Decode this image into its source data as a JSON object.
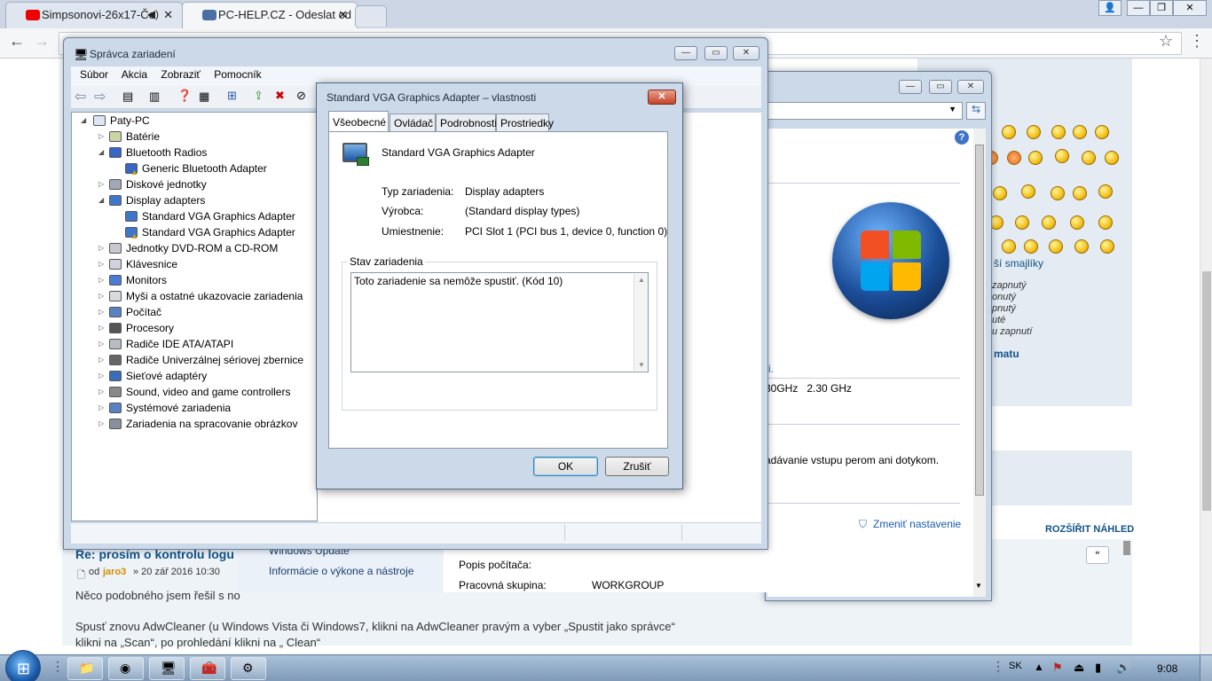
{
  "browser": {
    "tabs": [
      {
        "label": "Simpsonovi-26x17-Če",
        "active": false
      },
      {
        "label": "PC-HELP.CZ - Odeslat od",
        "active": true
      }
    ]
  },
  "page": {
    "post_title": "Re: prosím o kontrolu logu",
    "post_meta_prefix": "od",
    "post_author": "jaro3",
    "post_date": "» 20 zář 2016 10:30",
    "post_text1": "Něco podobného jsem řešil s no",
    "post_text2": "Spusť znovu AdwCleaner (u Windows Vista či Windows7, klikni na AdwCleaner pravým a vyber „Spustit jako správce“",
    "post_text3": "klikni na „Scan“, po prohledání klikni na „ Clean“",
    "expand_view": "ROZŠÍŘIT NÁHLED",
    "more_smileys": "ší smajlíky",
    "opts": [
      "zapnutý",
      "onutý",
      "pnutý",
      "uté",
      "u zapnutí"
    ],
    "opt_bold": "matu"
  },
  "sysinfo_window": {
    "fragment_i": "i.",
    "cpu_speed": "30GHz   2.30 GHz",
    "pen_text": "adávanie vstupu perom ani dotykom.",
    "change_settings": "Zmeniť nastavenie",
    "windows_update": "Windows Update",
    "perf_info": "Informácie o výkone a nástroje",
    "computer_desc_label": "Popis počítača:",
    "workgroup_label": "Pracovná skupina:",
    "workgroup_value": "WORKGROUP"
  },
  "devmgr": {
    "title": "Správca zariadení",
    "menu": [
      "Súbor",
      "Akcia",
      "Zobraziť",
      "Pomocník"
    ],
    "root": "Paty-PC",
    "nodes": [
      {
        "label": "Batérie",
        "level": 1,
        "icon": "battery-icon",
        "expanded": false
      },
      {
        "label": "Bluetooth Radios",
        "level": 1,
        "icon": "bluetooth-icon",
        "expanded": true
      },
      {
        "label": "Generic Bluetooth Adapter",
        "level": 2,
        "icon": "bluetooth-warning-icon"
      },
      {
        "label": "Diskové jednotky",
        "level": 1,
        "icon": "disk-icon",
        "expanded": false
      },
      {
        "label": "Display adapters",
        "level": 1,
        "icon": "display-adapter-icon",
        "expanded": true
      },
      {
        "label": "Standard VGA Graphics Adapter",
        "level": 2,
        "icon": "display-adapter-icon"
      },
      {
        "label": "Standard VGA Graphics Adapter",
        "level": 2,
        "icon": "display-warning-icon"
      },
      {
        "label": "Jednotky DVD-ROM a CD-ROM",
        "level": 1,
        "icon": "dvd-icon",
        "expanded": false
      },
      {
        "label": "Klávesnice",
        "level": 1,
        "icon": "keyboard-icon",
        "expanded": false
      },
      {
        "label": "Monitors",
        "level": 1,
        "icon": "monitor-icon",
        "expanded": false
      },
      {
        "label": "Myši a ostatné ukazovacie zariadenia",
        "level": 1,
        "icon": "mouse-icon",
        "expanded": false
      },
      {
        "label": "Počítač",
        "level": 1,
        "icon": "computer-icon",
        "expanded": false
      },
      {
        "label": "Procesory",
        "level": 1,
        "icon": "processor-icon",
        "expanded": false
      },
      {
        "label": "Radiče IDE ATA/ATAPI",
        "level": 1,
        "icon": "ide-icon",
        "expanded": false
      },
      {
        "label": "Radiče Univerzálnej sériovej zbernice",
        "level": 1,
        "icon": "usb-icon",
        "expanded": false
      },
      {
        "label": "Sieťové adaptéry",
        "level": 1,
        "icon": "network-icon",
        "expanded": false
      },
      {
        "label": "Sound, video and game controllers",
        "level": 1,
        "icon": "sound-icon",
        "expanded": false
      },
      {
        "label": "Systémové zariadenia",
        "level": 1,
        "icon": "system-icon",
        "expanded": false
      },
      {
        "label": "Zariadenia na spracovanie obrázkov",
        "level": 1,
        "icon": "camera-icon",
        "expanded": false
      }
    ]
  },
  "properties": {
    "title": "Standard VGA Graphics Adapter – vlastnosti",
    "tabs": [
      "Všeobecné",
      "Ovládač",
      "Podrobnosti",
      "Prostriedky"
    ],
    "device_name": "Standard VGA Graphics Adapter",
    "type_label": "Typ zariadenia:",
    "type_value": "Display adapters",
    "manufacturer_label": "Výrobca:",
    "manufacturer_value": "(Standard display types)",
    "location_label": "Umiestnenie:",
    "location_value": "PCI Slot 1 (PCI bus 1, device 0, function 0)",
    "status_group": "Stav zariadenia",
    "status_text": "Toto zariadenie sa nemôže spustiť. (Kód 10)",
    "ok": "OK",
    "cancel": "Zrušiť"
  },
  "taskbar": {
    "lang": "SK",
    "time": "9:08"
  }
}
